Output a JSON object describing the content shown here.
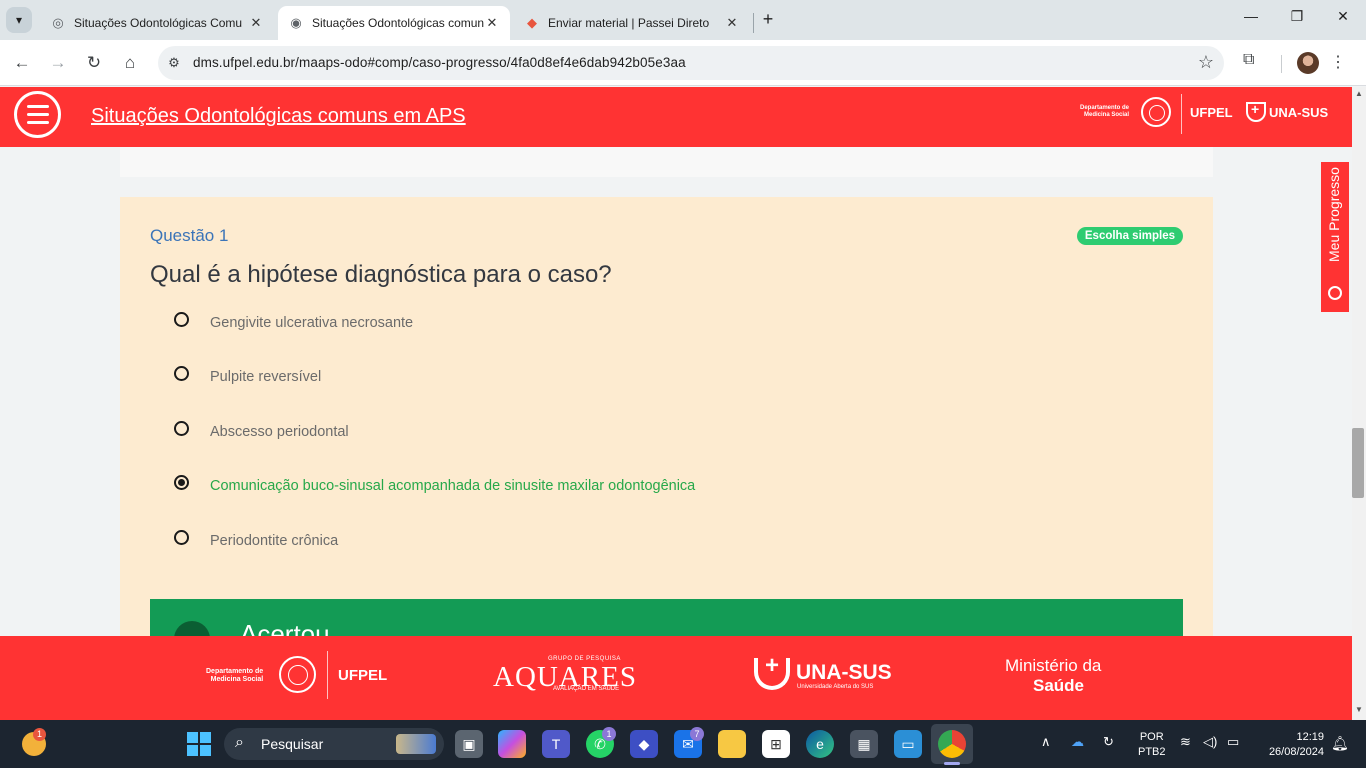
{
  "browser": {
    "tabs": [
      {
        "title": "Situações Odontológicas Comu",
        "active": false
      },
      {
        "title": "Situações Odontológicas comun",
        "active": true
      },
      {
        "title": "Enviar material | Passei Direto",
        "active": false
      }
    ],
    "url": "dms.ufpel.edu.br/maaps-odo#comp/caso-progresso/4fa0d8ef4e6dab942b05e3aa"
  },
  "header": {
    "title": "Situações Odontológicas comuns em APS",
    "dept_line1": "Departamento de",
    "dept_line2": "Medicina Social",
    "ufpel": "UFPEL",
    "unasus": "UNA-SUS"
  },
  "question": {
    "number": "Questão 1",
    "badge": "Escolha simples",
    "text": "Qual é a hipótese diagnóstica para o caso?",
    "options": [
      {
        "label": "Gengivite ulcerativa necrosante",
        "selected": false
      },
      {
        "label": "Pulpite reversível",
        "selected": false
      },
      {
        "label": "Abscesso periodontal",
        "selected": false
      },
      {
        "label": "Comunicação buco-sinusal acompanhada de sinusite maxilar odontogênica",
        "selected": true
      },
      {
        "label": "Periodontite crônica",
        "selected": false
      }
    ],
    "result": "Acertou"
  },
  "side_tab": {
    "label": "Meu Progresso"
  },
  "footer": {
    "dept_line1": "Departamento de",
    "dept_line2": "Medicina Social",
    "ufpel": "UFPEL",
    "aquares_top": "GRUPO DE PESQUISA",
    "aquares": "AQUARES",
    "aquares_sub": "AVALIAÇÃO EM SAÚDE",
    "unasus": "UNA-SUS",
    "unasus_sub": "Universidade Aberta do SUS",
    "ministry_line1": "Ministério da",
    "ministry_line2": "Saúde"
  },
  "taskbar": {
    "weather_badge": "1",
    "search_placeholder": "Pesquisar",
    "whatsapp_badge": "1",
    "mail_badge": "7",
    "lang_line1": "POR",
    "lang_line2": "PTB2",
    "time": "12:19",
    "date": "26/08/2024"
  },
  "colors": {
    "brand_red": "#ff3333",
    "card_bg": "#fdebd0",
    "success_green": "#139b55",
    "question_blue": "#3b74b8"
  }
}
